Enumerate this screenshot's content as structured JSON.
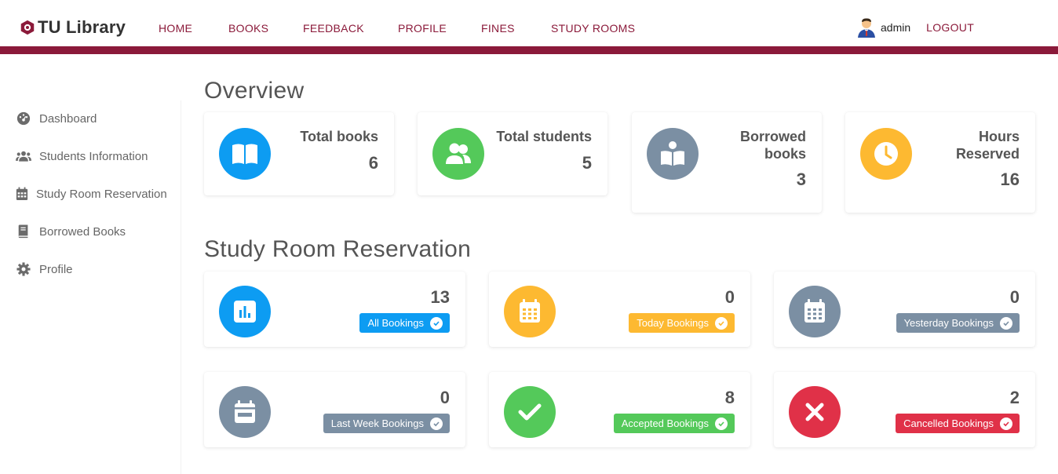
{
  "brand": {
    "name": "TU Library",
    "color": "#8b1a3a"
  },
  "nav": {
    "items": [
      {
        "label": "HOME"
      },
      {
        "label": "BOOKS"
      },
      {
        "label": "FEEDBACK"
      },
      {
        "label": "PROFILE"
      },
      {
        "label": "FINES"
      },
      {
        "label": "STUDY ROOMS"
      }
    ],
    "user": "admin",
    "logout": "LOGOUT"
  },
  "sidebar": {
    "items": [
      {
        "label": "Dashboard",
        "icon": "dashboard-icon"
      },
      {
        "label": "Students Information",
        "icon": "users-icon"
      },
      {
        "label": "Study Room Reservation",
        "icon": "calendar-icon"
      },
      {
        "label": "Borrowed Books",
        "icon": "book-icon"
      },
      {
        "label": "Profile",
        "icon": "gear-icon"
      }
    ]
  },
  "overview": {
    "title": "Overview",
    "cards": [
      {
        "label": "Total books",
        "value": "6",
        "color": "#0d9cf2",
        "icon": "open-book-icon"
      },
      {
        "label": "Total students",
        "value": "5",
        "color": "#54c95a",
        "icon": "users-icon"
      },
      {
        "label": "Borrowed books",
        "value": "3",
        "color": "#7b8fa3",
        "icon": "reader-icon"
      },
      {
        "label": "Hours Reserved",
        "value": "16",
        "color": "#fdb931",
        "icon": "clock-icon"
      }
    ]
  },
  "reservations": {
    "title": "Study Room Reservation",
    "cards": [
      {
        "label": "All Bookings",
        "value": "13",
        "color": "#0d9cf2",
        "icon": "chart-icon"
      },
      {
        "label": "Today Bookings",
        "value": "0",
        "color": "#fdb931",
        "icon": "calendar-icon"
      },
      {
        "label": "Yesterday Bookings",
        "value": "0",
        "color": "#7b8fa3",
        "icon": "calendar-icon"
      },
      {
        "label": "Last Week Bookings",
        "value": "0",
        "color": "#7b8fa3",
        "icon": "calendar-week-icon"
      },
      {
        "label": "Accepted Bookings",
        "value": "8",
        "color": "#54c95a",
        "icon": "check-icon"
      },
      {
        "label": "Cancelled Bookings",
        "value": "2",
        "color": "#e03148",
        "icon": "x-icon"
      }
    ]
  }
}
